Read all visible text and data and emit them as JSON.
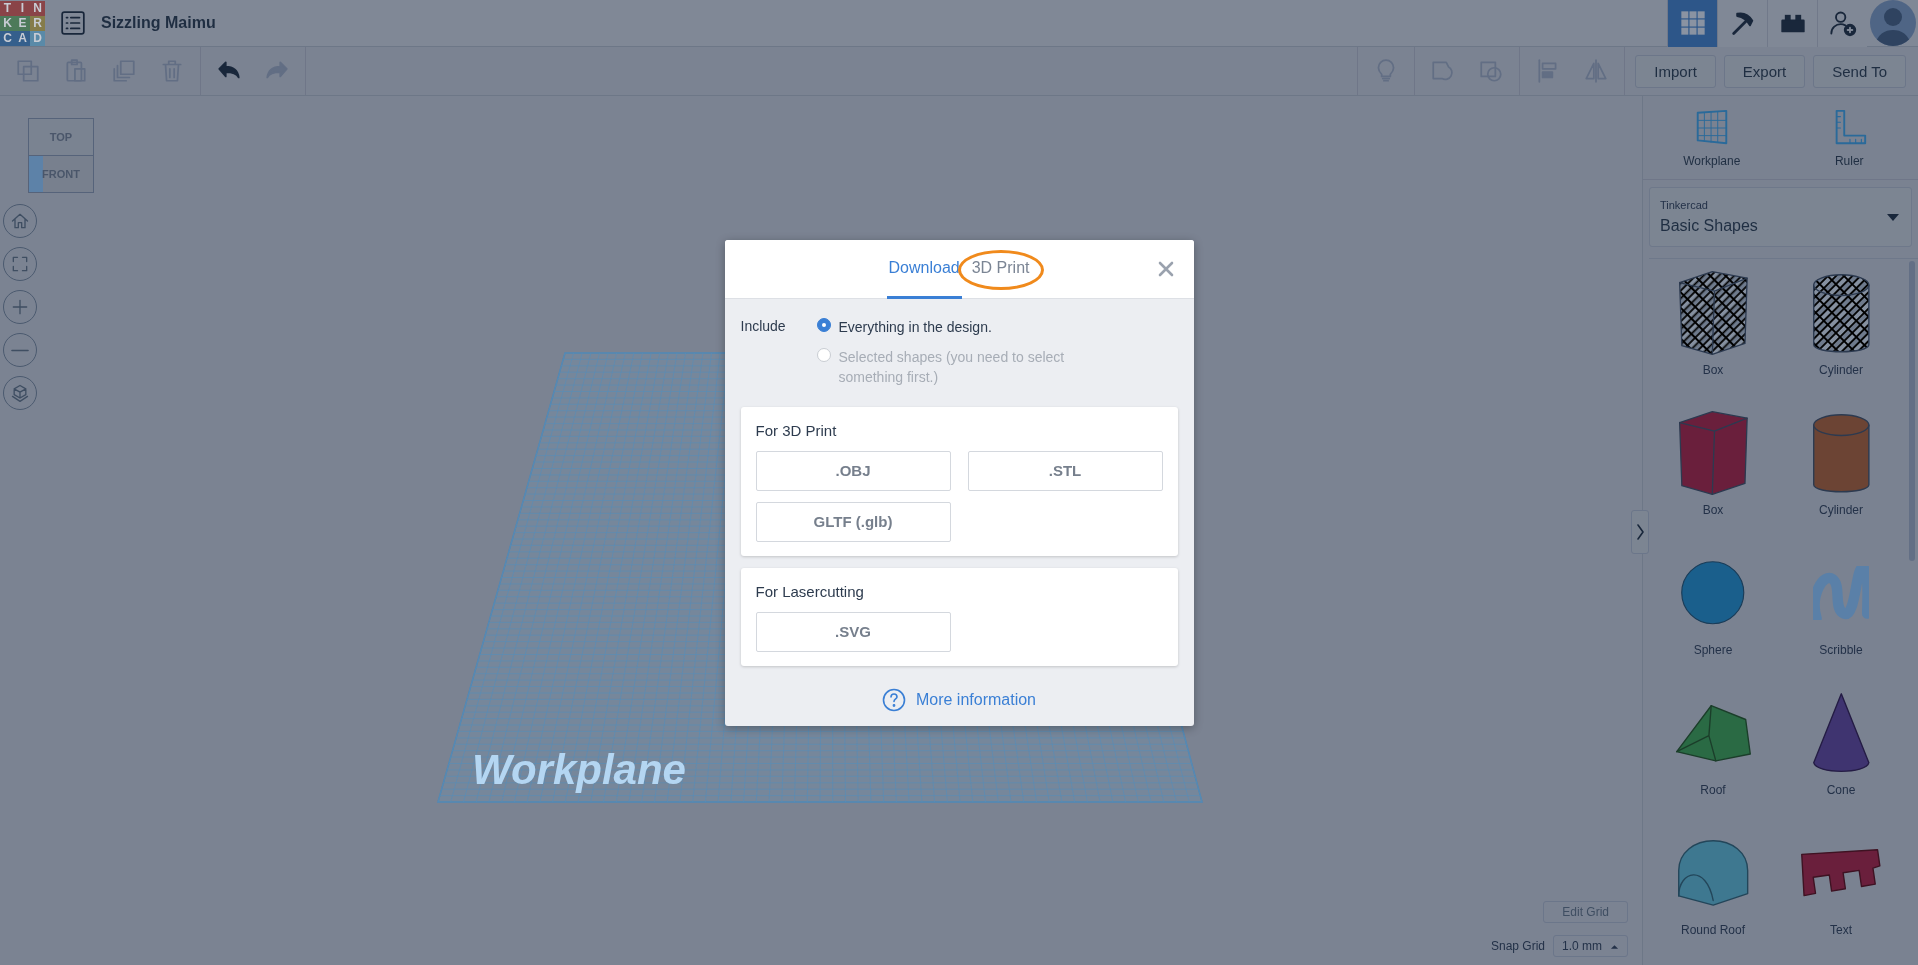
{
  "topbar": {
    "logo_letters": [
      {
        "letter": "T",
        "color": "#8a4448"
      },
      {
        "letter": "I",
        "color": "#8a4448"
      },
      {
        "letter": "N",
        "color": "#8a4448"
      },
      {
        "letter": "K",
        "color": "#4d7a5a"
      },
      {
        "letter": "E",
        "color": "#4d7a5a"
      },
      {
        "letter": "R",
        "color": "#857c4a"
      },
      {
        "letter": "C",
        "color": "#355f8c"
      },
      {
        "letter": "A",
        "color": "#355f8c"
      },
      {
        "letter": "D",
        "color": "#5a8aa8"
      }
    ],
    "design_title": "Sizzling Maimu",
    "nav_buttons": [
      {
        "kind": "grid",
        "selected": true
      },
      {
        "kind": "pickaxe",
        "selected": false
      },
      {
        "kind": "bricks",
        "selected": false
      },
      {
        "kind": "user-add",
        "selected": false
      }
    ]
  },
  "toolbar": {
    "left_groups": [
      [
        {
          "kind": "copy",
          "disabled": true
        },
        {
          "kind": "paste",
          "disabled": true
        },
        {
          "kind": "duplicate",
          "disabled": true
        },
        {
          "kind": "delete",
          "disabled": true
        }
      ],
      [
        {
          "kind": "undo",
          "disabled": false
        },
        {
          "kind": "redo",
          "disabled": true
        }
      ]
    ],
    "right_groups": [
      [
        {
          "kind": "lightbulb",
          "disabled": true
        }
      ],
      [
        {
          "kind": "group",
          "disabled": true
        },
        {
          "kind": "ungroup",
          "disabled": true
        }
      ],
      [
        {
          "kind": "align",
          "disabled": true
        },
        {
          "kind": "mirror",
          "disabled": true
        }
      ]
    ],
    "actions": [
      "Import",
      "Export",
      "Send To"
    ]
  },
  "canvas": {
    "view_cube": {
      "top": "TOP",
      "front": "FRONT"
    },
    "view_controls": [
      {
        "kind": "home"
      },
      {
        "kind": "fit"
      },
      {
        "kind": "zoom-in"
      },
      {
        "kind": "zoom-out"
      },
      {
        "kind": "perspective"
      }
    ],
    "workplane_label": "Workplane",
    "edit_grid": "Edit Grid",
    "snap_grid_label": "Snap Grid",
    "snap_grid_value": "1.0 mm"
  },
  "side_panel": {
    "tools": [
      {
        "kind": "workplane",
        "label": "Workplane"
      },
      {
        "kind": "ruler",
        "label": "Ruler"
      }
    ],
    "library": {
      "label": "Tinkercad",
      "value": "Basic Shapes"
    },
    "shapes": [
      {
        "kind": "box-hole",
        "label": "Box"
      },
      {
        "kind": "cylinder-hole",
        "label": "Cylinder"
      },
      {
        "kind": "box",
        "label": "Box",
        "color": "#6a1f3c"
      },
      {
        "kind": "cylinder",
        "label": "Cylinder",
        "color": "#6c4434"
      },
      {
        "kind": "sphere",
        "label": "Sphere",
        "color": "#1a5f8c"
      },
      {
        "kind": "scribble",
        "label": "Scribble",
        "color": "#5a80a8"
      },
      {
        "kind": "roof",
        "label": "Roof",
        "color": "#2a6a44"
      },
      {
        "kind": "cone",
        "label": "Cone",
        "color": "#3f3470"
      },
      {
        "kind": "round-roof",
        "label": "Round Roof",
        "color": "#3e7890"
      },
      {
        "kind": "text",
        "label": "Text",
        "color": "#6a1f3c"
      }
    ]
  },
  "export_dialog": {
    "tabs": [
      {
        "label": "Download",
        "selected": true,
        "circled": false
      },
      {
        "label": "3D Print",
        "selected": false,
        "circled": true
      }
    ],
    "include_label": "Include",
    "options": [
      {
        "label": "Everything in the design.",
        "selected": true,
        "disabled": false
      },
      {
        "label": "Selected shapes (you need to select something first.)",
        "selected": false,
        "disabled": true
      }
    ],
    "sections": [
      {
        "title": "For 3D Print",
        "buttons": [
          ".OBJ",
          ".STL",
          "GLTF (.glb)"
        ]
      },
      {
        "title": "For Lasercutting",
        "buttons": [
          ".SVG"
        ]
      }
    ],
    "more_info": "More information"
  }
}
